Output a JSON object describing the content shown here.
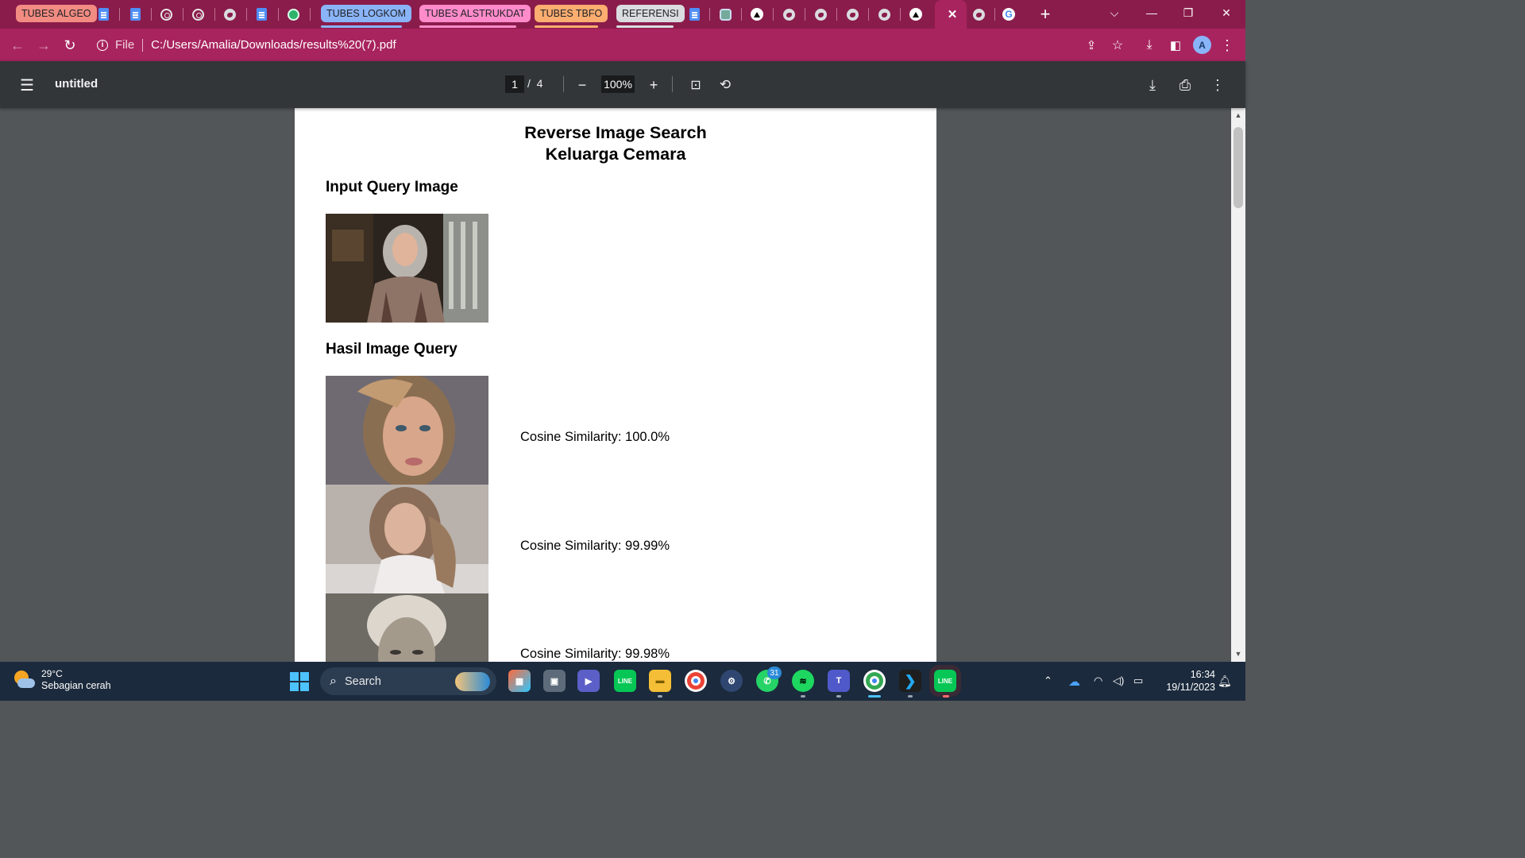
{
  "browser": {
    "tab_groups": [
      {
        "label": "TUBES ALGEO",
        "color": "#f28b82"
      },
      {
        "label": "TUBES LOGKOM",
        "color": "#8ab4f8"
      },
      {
        "label": "TUBES ALSTRUKDAT",
        "color": "#ff8bcb"
      },
      {
        "label": "TUBES TBFO",
        "color": "#fcad70"
      },
      {
        "label": "REFERENSI",
        "color": "#dadce0"
      }
    ],
    "active_tab_icon": "close-icon",
    "new_tab_icon": "plus-icon"
  },
  "addressbar": {
    "scheme_label": "File",
    "url": "C:/Users/Amalia/Downloads/results%20(7).pdf",
    "profile_initial": "A"
  },
  "pdf_toolbar": {
    "title": "untitled",
    "current_page": "1",
    "page_separator": "/",
    "total_pages": "4",
    "zoom": "100%"
  },
  "document": {
    "title_line1": "Reverse Image Search",
    "title_line2": "Keluarga Cemara",
    "input_heading": "Input Query Image",
    "results_heading": "Hasil Image Query",
    "results": [
      {
        "similarity_text": "Cosine Similarity: 100.0%"
      },
      {
        "similarity_text": "Cosine Similarity: 99.99%"
      },
      {
        "similarity_text": "Cosine Similarity: 99.98%"
      }
    ]
  },
  "taskbar": {
    "weather_temp": "29°C",
    "weather_desc": "Sebagian cerah",
    "search_label": "Search",
    "notification_badge": "31",
    "clock_time": "16:34",
    "clock_date": "19/11/2023"
  },
  "colors": {
    "tabstrip": "#8a1c4b",
    "toolbar": "#a8245e",
    "pdf_toolbar": "#323639",
    "viewer_bg": "#525659",
    "taskbar": "#1b2a3c"
  }
}
